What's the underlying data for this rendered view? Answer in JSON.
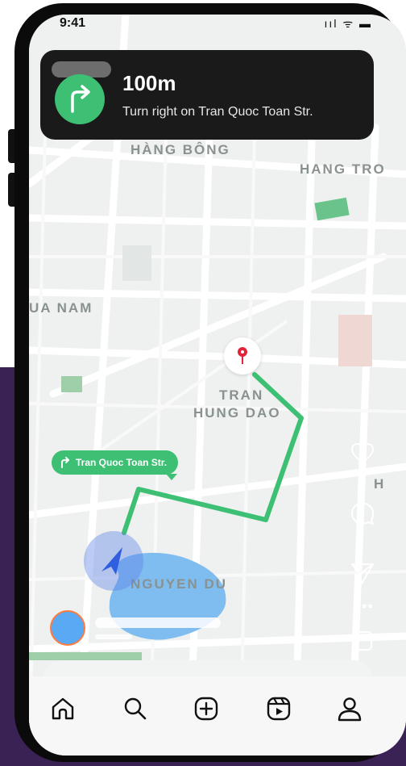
{
  "status_bar": {
    "time": "9:41",
    "icons": "ııl ᯤ ▬"
  },
  "navigation": {
    "distance": "100m",
    "instruction": "Turn right on Tran Quoc Toan Str.",
    "turn_icon": "turn-right-arrow-icon"
  },
  "map": {
    "labels": {
      "hang_bong": "HÀNG BÔNG",
      "hang_tro": "HANG TRO",
      "ua_nam": "UA NAM",
      "tran": "TRAN",
      "hung_dao": "HUNG DAO",
      "h": "H",
      "nguyen_du": "NGUYEN DU"
    },
    "route_tag": "Tran Quoc Toan Str.",
    "route_color": "#3dbf74",
    "pin_color": "#e2243b",
    "location_color": "#2f5ee0"
  },
  "side_actions": [
    "heart-icon",
    "comment-icon",
    "send-icon",
    "more-icon",
    "bookmark-icon"
  ],
  "tab_bar": [
    "home-icon",
    "search-icon",
    "add-icon",
    "reels-icon",
    "profile-icon"
  ],
  "colors": {
    "background_accent": "#3a2254",
    "banner": "#1a1a1a"
  }
}
